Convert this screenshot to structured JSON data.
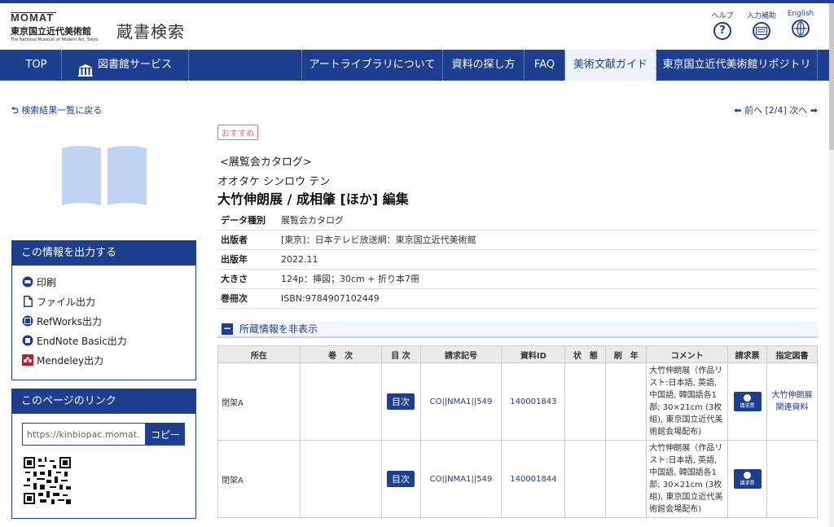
{
  "header": {
    "logo_mark": "MOMAT",
    "logo_jp": "東京国立近代美術館",
    "logo_en": "The National Museum of Modern Art, Tokyo",
    "site_title": "蔵書検索",
    "help_label": "ヘルプ",
    "assist_label": "入力補助",
    "english_label": "English"
  },
  "nav": {
    "top": "TOP",
    "library": "図書館サービス",
    "about": "アートライブラリについて",
    "search_help": "資料の探し方",
    "faq": "FAQ",
    "guide": "美術文献ガイド",
    "repository": "東京国立近代美術館リポジトリ"
  },
  "backlink": "検索結果一覧に戻る",
  "pager": {
    "prev": "前へ",
    "position": "[2/4]",
    "next": "次へ"
  },
  "output_panel": {
    "title": "この情報を出力する",
    "items": [
      "印刷",
      "ファイル出力",
      "RefWorks出力",
      "EndNote Basic出力",
      "Mendeley出力"
    ]
  },
  "link_panel": {
    "title": "このページのリンク",
    "url": "https://kinbiopac.momat.",
    "copy": "コピー"
  },
  "record": {
    "badge": "おすすめ",
    "type": "<展覧会カタログ>",
    "reading": "オオタケ シンロウ テン",
    "title": "大竹伸朗展 / 成相肇 [ほか] 編集",
    "meta": [
      {
        "key": "データ種別",
        "value": "展覧会カタログ"
      },
      {
        "key": "出版者",
        "value": "[東京]：日本テレビ放送網：東京国立近代美術館"
      },
      {
        "key": "出版年",
        "value": "2022.11"
      },
      {
        "key": "大きさ",
        "value": "124p：挿図；30cm + 折り本7冊"
      },
      {
        "key": "巻冊次",
        "value": "ISBN:9784907102449"
      }
    ]
  },
  "holdings": {
    "toggle": "所蔵情報を非表示",
    "headers": [
      "所在",
      "巻　次",
      "目 次",
      "請求記号",
      "資料ID",
      "状　態",
      "刷　年",
      "コメント",
      "請求票",
      "指定図書"
    ],
    "rows": [
      {
        "location": "閉架A",
        "volume": "",
        "toc": "目次",
        "call_no": "CO||NMA1||549",
        "id": "140001843",
        "status": "",
        "year": "",
        "comment": "大竹伸朗展（作品リスト:日本語, 英語, 中国語, 韓国語各1部; 30×21cm (3枚組), 東京国立近代美術館会場配布)",
        "request": "請求票",
        "reserve": "大竹伸朗展関連資料"
      },
      {
        "location": "閉架A",
        "volume": "",
        "toc": "目次",
        "call_no": "CO||NMA1||549",
        "id": "140001844",
        "status": "",
        "year": "",
        "comment": "大竹伸朗展（作品リスト:日本語, 英語, 中国語, 韓国語各1部; 30×21cm (3枚組), 東京国立近代美術館会場配布)",
        "request": "請求票",
        "reserve": ""
      }
    ]
  },
  "colors": {
    "brand": "#1e3f8f",
    "badge": "#e06b8b",
    "book": "#c0d3f2"
  }
}
